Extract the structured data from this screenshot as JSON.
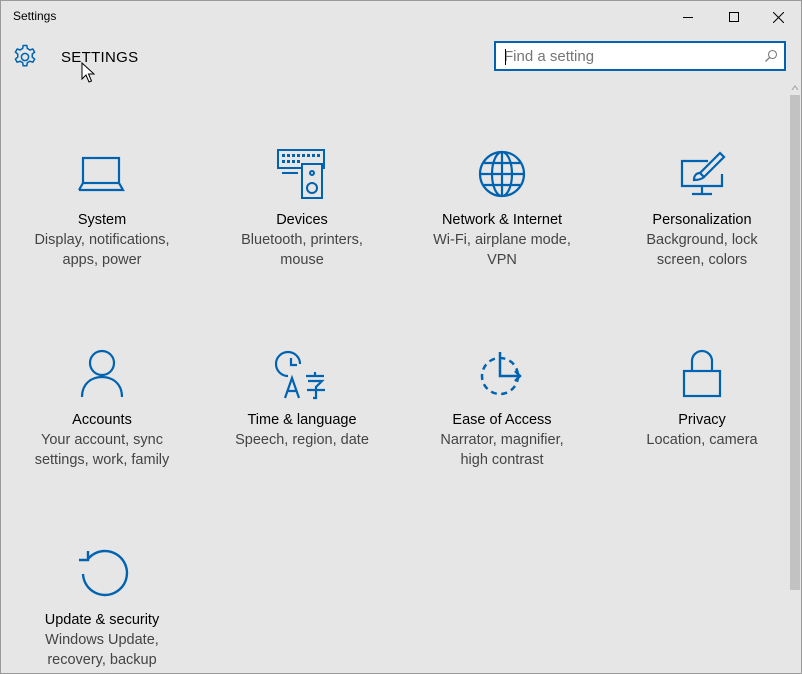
{
  "window": {
    "title": "Settings"
  },
  "header": {
    "title": "SETTINGS"
  },
  "search": {
    "placeholder": "Find a setting",
    "value": ""
  },
  "accent_color": "#0063b1",
  "tiles": [
    {
      "icon": "laptop-icon",
      "title": "System",
      "desc": [
        "Display, notifications,",
        "apps, power"
      ]
    },
    {
      "icon": "devices-icon",
      "title": "Devices",
      "desc": [
        "Bluetooth, printers,",
        "mouse"
      ]
    },
    {
      "icon": "globe-icon",
      "title": "Network & Internet",
      "desc": [
        "Wi-Fi, airplane mode,",
        "VPN"
      ]
    },
    {
      "icon": "paintbrush-icon",
      "title": "Personalization",
      "desc": [
        "Background, lock",
        "screen, colors"
      ]
    },
    {
      "icon": "person-icon",
      "title": "Accounts",
      "desc": [
        "Your account, sync",
        "settings, work, family"
      ]
    },
    {
      "icon": "time-language-icon",
      "title": "Time & language",
      "desc": [
        "Speech, region, date",
        ""
      ]
    },
    {
      "icon": "ease-of-access-icon",
      "title": "Ease of Access",
      "desc": [
        "Narrator, magnifier,",
        "high contrast"
      ]
    },
    {
      "icon": "lock-icon",
      "title": "Privacy",
      "desc": [
        "Location, camera",
        ""
      ]
    },
    {
      "icon": "refresh-icon",
      "title": "Update & security",
      "desc": [
        "Windows Update,",
        "recovery, backup"
      ]
    }
  ]
}
